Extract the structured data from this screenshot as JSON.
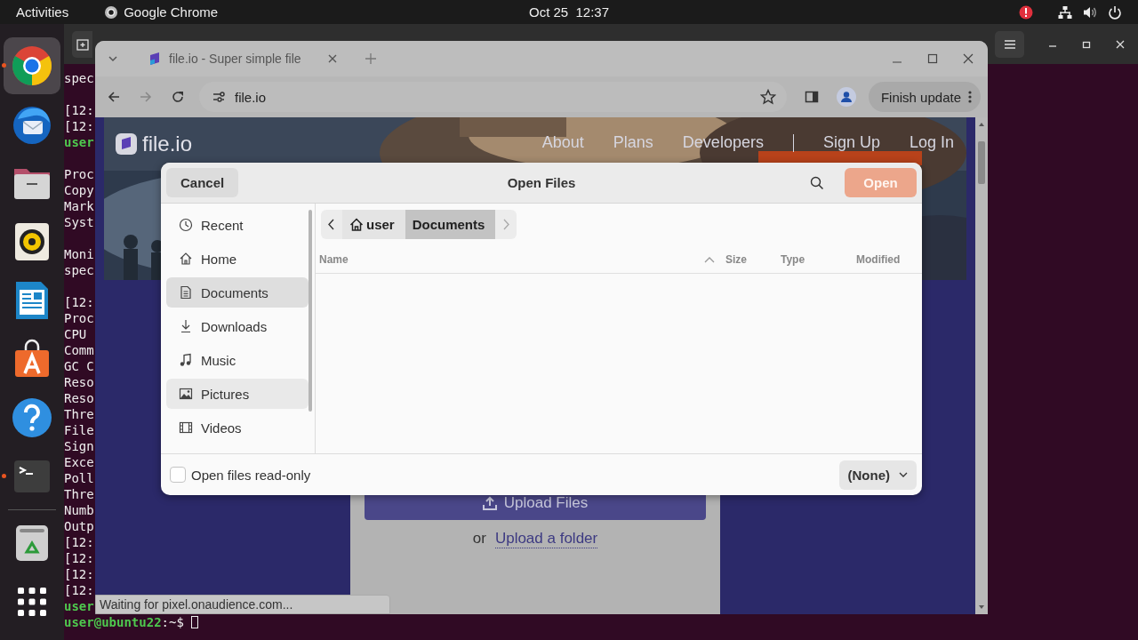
{
  "top_bar": {
    "activities": "Activities",
    "app": "Google Chrome",
    "clock": "Oct 25  12:37"
  },
  "dock": [
    {
      "kind": "browser",
      "running": true,
      "selected": true
    },
    {
      "kind": "mail",
      "running": false,
      "selected": false
    },
    {
      "kind": "files",
      "running": false,
      "selected": false
    },
    {
      "kind": "music",
      "running": false,
      "selected": false
    },
    {
      "kind": "writer",
      "running": false,
      "selected": false
    },
    {
      "kind": "store",
      "running": false,
      "selected": false
    },
    {
      "kind": "help",
      "running": false,
      "selected": false
    },
    {
      "kind": "terminal",
      "running": true,
      "selected": false
    },
    {
      "kind": "trash",
      "running": false,
      "selected": false
    },
    {
      "kind": "apps",
      "running": false,
      "selected": false
    }
  ],
  "terminal": {
    "blocks": [
      [
        {
          "text": "spec",
          "kind": "output"
        }
      ],
      [
        {
          "text": "[12:",
          "kind": "output"
        },
        {
          "text": "[12:",
          "kind": "output"
        },
        {
          "text": "user",
          "kind": "prompt"
        }
      ],
      [
        {
          "text": "Proc",
          "kind": "output"
        },
        {
          "text": "Copy",
          "kind": "output"
        },
        {
          "text": "Mark",
          "kind": "output"
        },
        {
          "text": "Syst",
          "kind": "output"
        }
      ],
      [
        {
          "text": "Moni",
          "kind": "output"
        },
        {
          "text": "spec",
          "kind": "output"
        }
      ],
      [
        {
          "text": "[12:",
          "kind": "output"
        },
        {
          "text": "Proc",
          "kind": "output"
        },
        {
          "text": "CPU",
          "kind": "output"
        },
        {
          "text": "Comm",
          "kind": "output"
        },
        {
          "text": "GC C",
          "kind": "output"
        },
        {
          "text": "Reso",
          "kind": "output"
        },
        {
          "text": "Reso",
          "kind": "output"
        },
        {
          "text": "Thre",
          "kind": "output"
        },
        {
          "text": "File",
          "kind": "output"
        },
        {
          "text": "Sign",
          "kind": "output"
        },
        {
          "text": "Exce",
          "kind": "output"
        },
        {
          "text": "Poll",
          "kind": "output"
        },
        {
          "text": "Thre",
          "kind": "output"
        },
        {
          "text": "Numb",
          "kind": "output"
        },
        {
          "text": "Outp",
          "kind": "output"
        },
        {
          "text": "[12:",
          "kind": "output"
        },
        {
          "text": "[12:",
          "kind": "output"
        },
        {
          "text": "[12:",
          "kind": "output"
        },
        {
          "text": "[12:",
          "kind": "output"
        },
        {
          "text": "user",
          "kind": "prompt"
        }
      ]
    ],
    "prompt": {
      "user": "user@ubuntu22",
      "path": ":~$"
    }
  },
  "browser": {
    "tab_title": "file.io - Super simple file",
    "address": "file.io",
    "update_button": "Finish update",
    "site": {
      "logo": "file.io",
      "nav": [
        "About",
        "Plans",
        "Developers",
        "Sign Up",
        "Log In"
      ],
      "upload_button": "Upload Files",
      "or": "or",
      "folder_link": "Upload a folder"
    },
    "status": "Waiting for pixel.onaudience.com..."
  },
  "dialog": {
    "cancel": "Cancel",
    "title": "Open Files",
    "open": {
      "label": "Open",
      "disabled": true
    },
    "places": [
      {
        "label": "Recent",
        "kind": "recent",
        "selected": false,
        "hovered": false
      },
      {
        "label": "Home",
        "kind": "home",
        "selected": false,
        "hovered": false
      },
      {
        "label": "Documents",
        "kind": "documents",
        "selected": true,
        "hovered": false
      },
      {
        "label": "Downloads",
        "kind": "downloads",
        "selected": false,
        "hovered": false
      },
      {
        "label": "Music",
        "kind": "music",
        "selected": false,
        "hovered": false
      },
      {
        "label": "Pictures",
        "kind": "pictures",
        "selected": false,
        "hovered": true
      },
      {
        "label": "Videos",
        "kind": "videos",
        "selected": false,
        "hovered": false
      }
    ],
    "path": [
      {
        "label": "user",
        "kind": "home",
        "selected": false
      },
      {
        "label": "Documents",
        "kind": "folder",
        "selected": true
      }
    ],
    "columns": [
      {
        "label": "Name",
        "sorted": true
      },
      {
        "label": "Size",
        "sorted": false
      },
      {
        "label": "Type",
        "sorted": false
      },
      {
        "label": "Modified",
        "sorted": false
      }
    ],
    "readonly": {
      "label": "Open files read-only",
      "checked": false
    },
    "filter": "(None)"
  }
}
